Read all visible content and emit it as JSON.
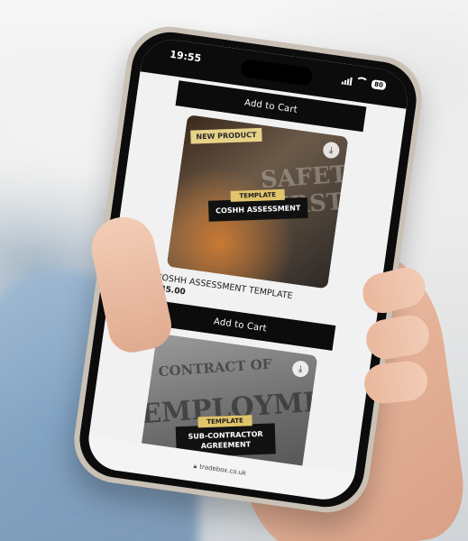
{
  "status_bar": {
    "time": "19:55",
    "battery": "80"
  },
  "buttons": {
    "add_to_cart_top": "Add to Cart",
    "add_to_cart_mid": "Add to Cart"
  },
  "products": [
    {
      "badge": "NEW PRODUCT",
      "background_text": "SAFETY FIRST",
      "template_tag": "TEMPLATE",
      "image_title": "COSHH ASSESSMENT",
      "name": "COSHH ASSESSMENT TEMPLATE",
      "price": "£35.00"
    },
    {
      "background_text_1": "CONTRACT OF",
      "background_text_2": "EMPLOYMENT",
      "template_tag": "TEMPLATE",
      "image_title_line1": "SUB-CONTRACTOR",
      "image_title_line2": "AGREEMENT"
    }
  ],
  "url_bar": {
    "url": "tradebox.co.uk"
  },
  "icons": {
    "download": "download-icon",
    "lock": "lock-icon",
    "wifi": "wifi-icon",
    "signal": "signal-icon",
    "battery": "battery-icon"
  }
}
